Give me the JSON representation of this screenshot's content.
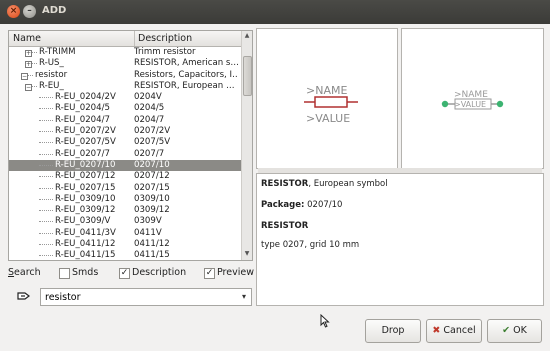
{
  "window": {
    "title": "ADD",
    "close_glyph": "×",
    "min_glyph": "–"
  },
  "list": {
    "headers": {
      "name": "Name",
      "description": "Description"
    },
    "rows": [
      {
        "name": "R-TRIMM",
        "description": "Trimm resistor",
        "level": 1,
        "twisty": "+",
        "selected": false
      },
      {
        "name": "R-US_",
        "description": "RESISTOR, American s…",
        "level": 1,
        "twisty": "+",
        "selected": false
      },
      {
        "name": "resistor",
        "description": "Resistors, Capacitors, I…",
        "level": 0,
        "twisty": "−",
        "selected": false
      },
      {
        "name": "R-EU_",
        "description": "RESISTOR, European …",
        "level": 1,
        "twisty": "−",
        "selected": false
      },
      {
        "name": "R-EU_0204/2V",
        "description": "0204V",
        "level": 2,
        "selected": false
      },
      {
        "name": "R-EU_0204/5",
        "description": "0204/5",
        "level": 2,
        "selected": false
      },
      {
        "name": "R-EU_0204/7",
        "description": "0204/7",
        "level": 2,
        "selected": false
      },
      {
        "name": "R-EU_0207/2V",
        "description": "0207/2V",
        "level": 2,
        "selected": false
      },
      {
        "name": "R-EU_0207/5V",
        "description": "0207/5V",
        "level": 2,
        "selected": false
      },
      {
        "name": "R-EU_0207/7",
        "description": "0207/7",
        "level": 2,
        "selected": false
      },
      {
        "name": "R-EU_0207/10",
        "description": "0207/10",
        "level": 2,
        "selected": true
      },
      {
        "name": "R-EU_0207/12",
        "description": "0207/12",
        "level": 2,
        "selected": false
      },
      {
        "name": "R-EU_0207/15",
        "description": "0207/15",
        "level": 2,
        "selected": false
      },
      {
        "name": "R-EU_0309/10",
        "description": "0309/10",
        "level": 2,
        "selected": false
      },
      {
        "name": "R-EU_0309/12",
        "description": "0309/12",
        "level": 2,
        "selected": false
      },
      {
        "name": "R-EU_0309/V",
        "description": "0309V",
        "level": 2,
        "selected": false
      },
      {
        "name": "R-EU_0411/3V",
        "description": "0411V",
        "level": 2,
        "selected": false
      },
      {
        "name": "R-EU_0411/12",
        "description": "0411/12",
        "level": 2,
        "selected": false
      },
      {
        "name": "R-EU_0411/15",
        "description": "0411/15",
        "level": 2,
        "selected": false
      }
    ]
  },
  "options": {
    "search_label": "Search",
    "smds_label": "Smds",
    "smds_checked": false,
    "description_label": "Description",
    "description_checked": true,
    "preview_label": "Preview",
    "preview_checked": true
  },
  "search": {
    "value": "resistor",
    "dropdown_glyph": "▾"
  },
  "symbol_preview": {
    "name_label": ">NAME",
    "value_label": ">VALUE"
  },
  "package_preview": {
    "name_label": ">NAME",
    "value_label": ">VALUE"
  },
  "info": {
    "title_bold": "RESISTOR",
    "title_rest": ", European symbol",
    "package_label": "Package:",
    "package_value": "0207/10",
    "heading": "RESISTOR",
    "detail": "type 0207, grid 10 mm"
  },
  "buttons": {
    "drop": "Drop",
    "cancel": "Cancel",
    "ok": "OK"
  },
  "colors": {
    "selection": "#8b8a86",
    "symbol_red": "#b03030",
    "pad_green": "#3cb371"
  }
}
